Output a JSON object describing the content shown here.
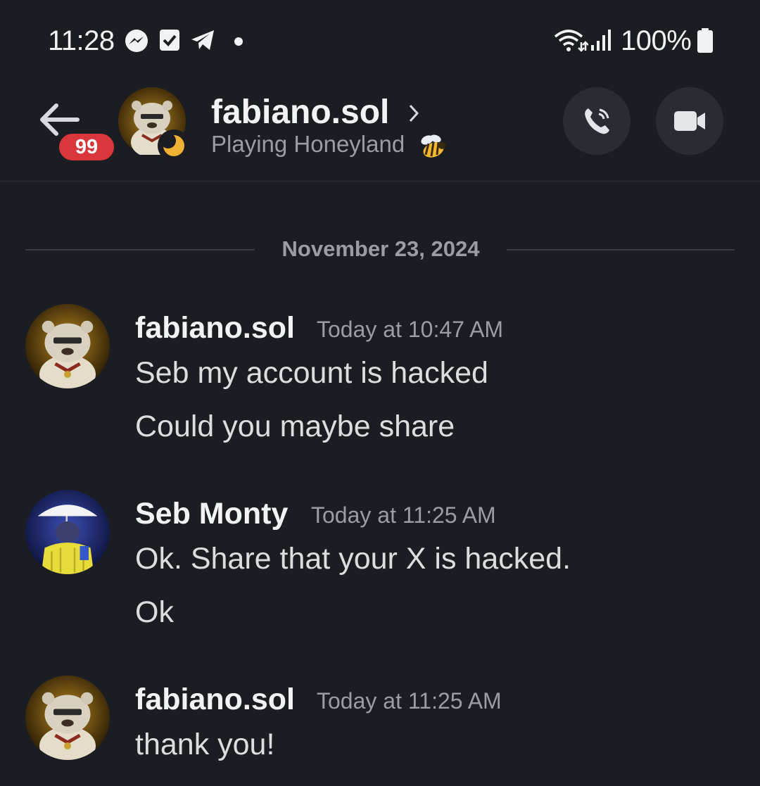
{
  "status_bar": {
    "time": "11:28",
    "battery": "100%",
    "notification_icons": [
      "messenger-icon",
      "checkbox-icon",
      "telegram-icon",
      "dot-icon"
    ],
    "system_icons": [
      "wifi-icon",
      "signal-icon",
      "battery-icon"
    ]
  },
  "header": {
    "unread_count": "99",
    "name": "fabiano.sol",
    "status": "Playing Honeyland",
    "status_icon": "bee-icon",
    "presence": "idle-moon-icon",
    "actions": [
      "phone-call-icon",
      "video-camera-icon"
    ]
  },
  "colors": {
    "background": "#1c1d22",
    "badge": "#da373c",
    "idle": "#f0b232",
    "button_bg": "#2b2c33"
  },
  "chat": {
    "date_divider": "November 23, 2024",
    "messages": [
      {
        "author": "fabiano.sol",
        "timestamp": "Today at 10:47 AM",
        "lines": [
          "Seb my account is hacked",
          "Could you maybe share"
        ]
      },
      {
        "author": "Seb Monty",
        "timestamp": "Today at 11:25 AM",
        "lines": [
          "Ok. Share that your X is hacked.",
          "Ok"
        ]
      },
      {
        "author": "fabiano.sol",
        "timestamp": "Today at 11:25 AM",
        "lines": [
          "thank you!"
        ]
      }
    ]
  }
}
